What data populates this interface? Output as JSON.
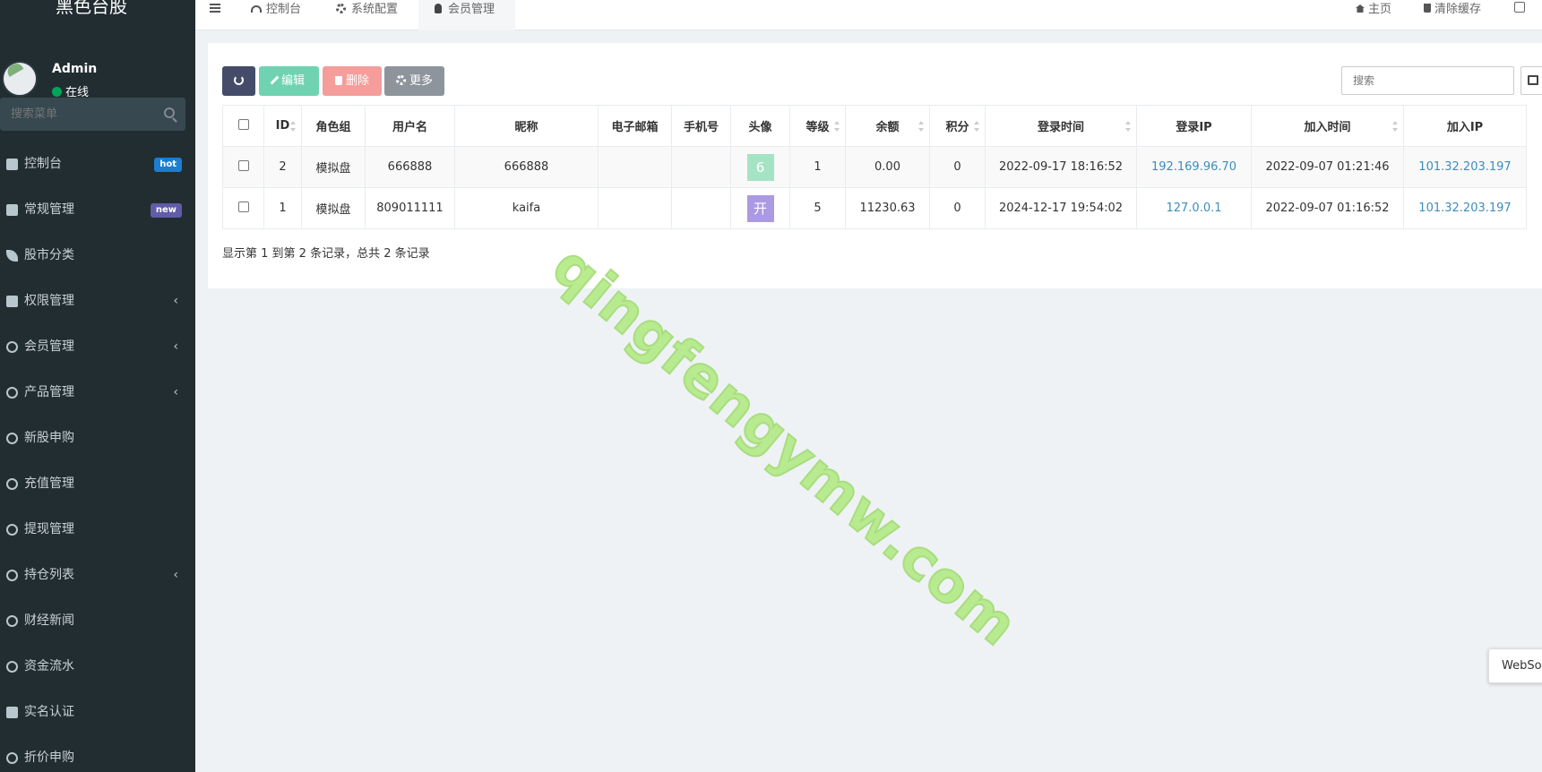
{
  "brand": "黑色台股",
  "user": {
    "name": "Admin",
    "status": "在线"
  },
  "sidebar_search": {
    "placeholder": "搜索菜单"
  },
  "menu": [
    {
      "label": "控制台",
      "icon": "dashboard-icon",
      "badge": "hot"
    },
    {
      "label": "常规管理",
      "icon": "cogs-icon",
      "badge": "new"
    },
    {
      "label": "股市分类",
      "icon": "leaf-icon"
    },
    {
      "label": "权限管理",
      "icon": "group-icon",
      "chevron": "‹"
    },
    {
      "label": "会员管理",
      "icon": "user-circle-icon",
      "chevron": "‹"
    },
    {
      "label": "产品管理",
      "icon": "circle-icon",
      "chevron": "‹"
    },
    {
      "label": "新股申购",
      "icon": "circle-icon"
    },
    {
      "label": "充值管理",
      "icon": "circle-icon"
    },
    {
      "label": "提现管理",
      "icon": "circle-icon"
    },
    {
      "label": "持仓列表",
      "icon": "circle-icon",
      "chevron": "‹"
    },
    {
      "label": "财经新闻",
      "icon": "circle-icon"
    },
    {
      "label": "资金流水",
      "icon": "circle-icon"
    },
    {
      "label": "实名认证",
      "icon": "credit-card-icon"
    },
    {
      "label": "折价申购",
      "icon": "circle-icon"
    }
  ],
  "topnav": {
    "tabs": [
      {
        "label": "控制台",
        "icon": "dashboard-icon"
      },
      {
        "label": "系统配置",
        "icon": "gear-icon"
      },
      {
        "label": "会员管理",
        "icon": "user-icon"
      }
    ],
    "home": "主页",
    "clear_cache": "清除缓存"
  },
  "toolbar": {
    "edit": "编辑",
    "delete": "删除",
    "more": "更多",
    "search_placeholder": "搜索",
    "colors": {
      "refresh": "#444c69",
      "edit": "#6fd3b1",
      "delete": "#f49d9a",
      "more": "#8d949c"
    }
  },
  "table": {
    "headers": [
      "ID",
      "角色组",
      "用户名",
      "昵称",
      "电子邮箱",
      "手机号",
      "头像",
      "等级",
      "余额",
      "积分",
      "登录时间",
      "登录IP",
      "加入时间",
      "加入IP"
    ],
    "rows": [
      {
        "id": "2",
        "group": "模拟盘",
        "username": "666888",
        "nickname": "666888",
        "email": "",
        "mobile": "",
        "avatar": "6",
        "avatar_color": "#a5e3c5",
        "level": "1",
        "money": "0.00",
        "score": "0",
        "logintime": "2022-09-17 18:16:52",
        "loginip": "192.169.96.70",
        "jointime": "2022-09-07 01:21:46",
        "joinip": "101.32.203.197"
      },
      {
        "id": "1",
        "group": "模拟盘",
        "username": "809011111",
        "nickname": "kaifa",
        "email": "",
        "mobile": "",
        "avatar": "开",
        "avatar_color": "#ab9ae3",
        "level": "5",
        "money": "11230.63",
        "score": "0",
        "logintime": "2024-12-17 19:54:02",
        "loginip": "127.0.0.1",
        "jointime": "2022-09-07 01:16:52",
        "joinip": "101.32.203.197"
      }
    ]
  },
  "pagination_info": "显示第 1 到第 2 条记录，总共 2 条记录",
  "watermark": "qingfengymw.com",
  "websocket_tip": "WebSoc"
}
